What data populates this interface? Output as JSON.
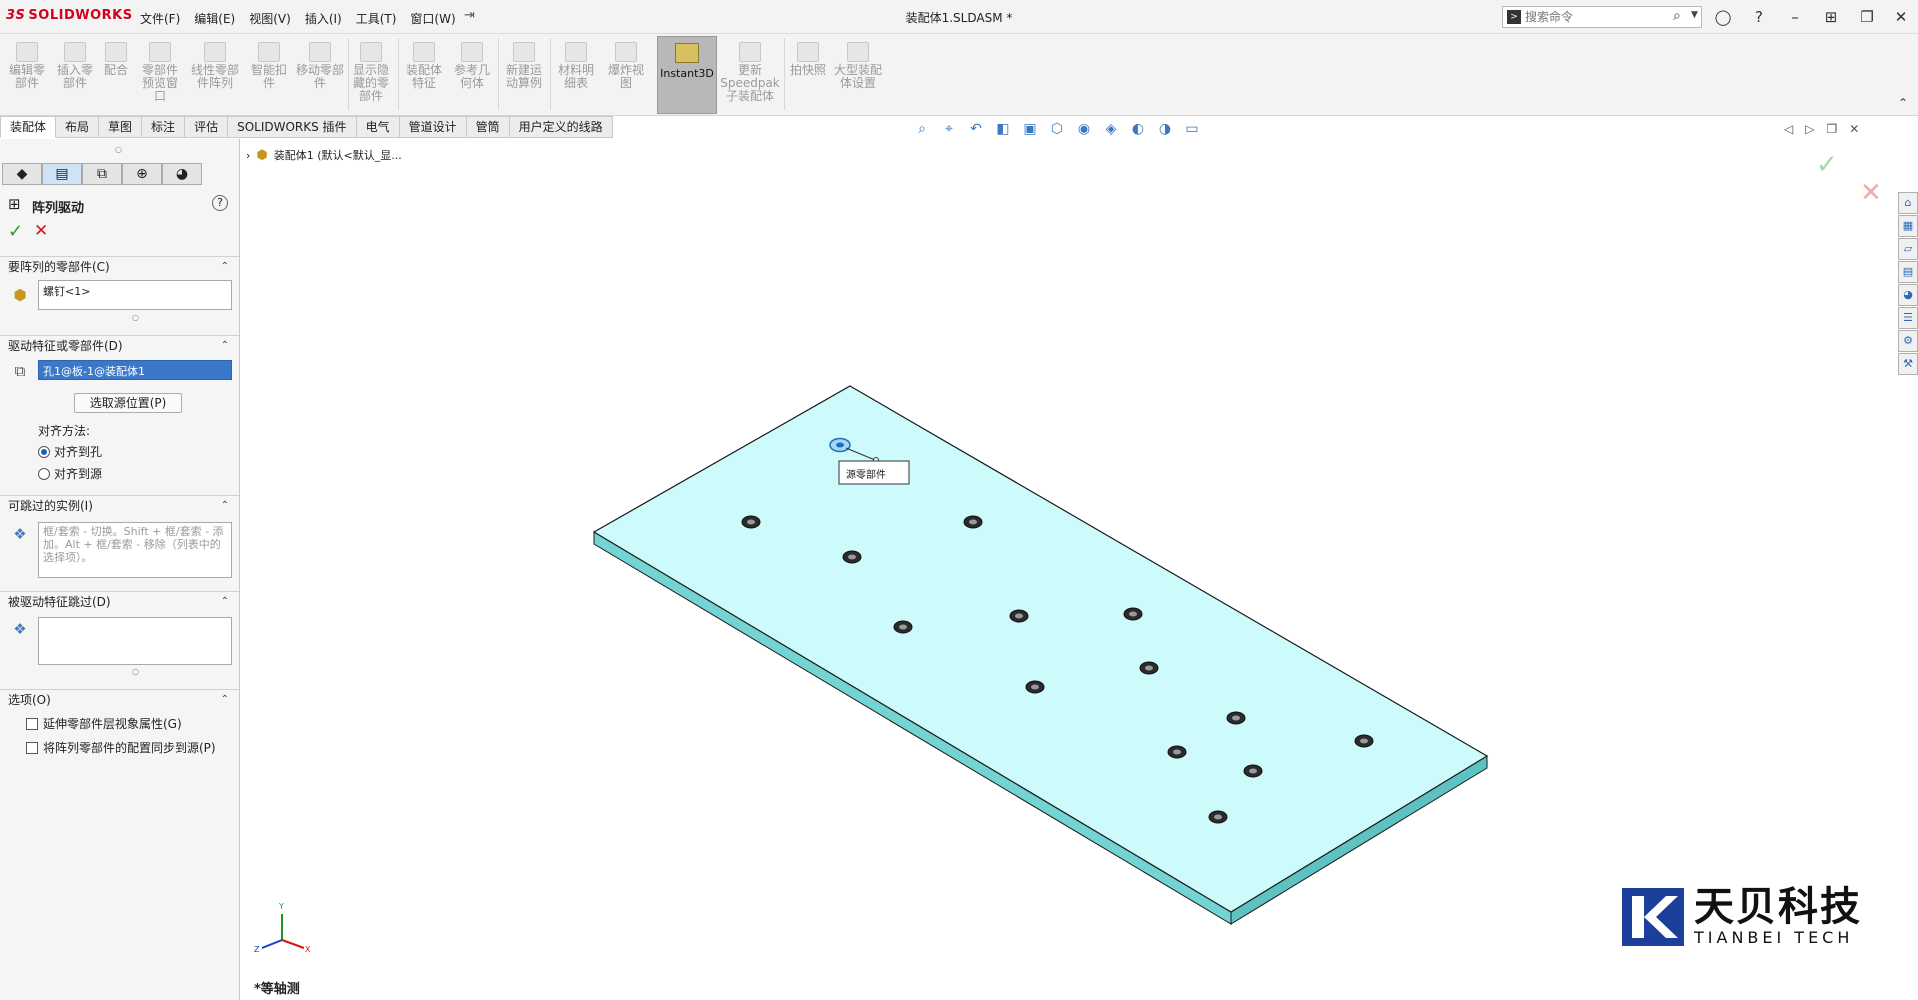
{
  "app": {
    "logo": "SOLIDWORKS",
    "logo_prefix": "3S",
    "document_title": "装配体1.SLDASM *",
    "menu": [
      "文件(F)",
      "编辑(E)",
      "视图(V)",
      "插入(I)",
      "工具(T)",
      "窗口(W)"
    ],
    "search_placeholder": "搜索命令"
  },
  "ribbon": {
    "buttons": [
      "编辑零部件",
      "插入零部件",
      "配合",
      "零部件预览窗口",
      "线性零部件阵列",
      "智能扣件",
      "移动零部件",
      "显示隐藏的零部件",
      "装配体特征",
      "参考几何体",
      "新建运动算例",
      "材料明细表",
      "爆炸视图",
      "Instant3D",
      "更新Speedpak子装配体",
      "拍快照",
      "大型装配体设置"
    ]
  },
  "tabs": [
    "装配体",
    "布局",
    "草图",
    "标注",
    "评估",
    "SOLIDWORKS 插件",
    "电气",
    "管道设计",
    "管筒",
    "用户定义的线路"
  ],
  "feature_tree_flyout": "装配体1  (默认<默认_显...",
  "property_manager": {
    "title": "阵列驱动",
    "sections": {
      "components": {
        "title": "要阵列的零部件(C)",
        "items": [
          "螺钉<1>"
        ]
      },
      "driving": {
        "title": "驱动特征或零部件(D)",
        "selected": "孔1@板-1@装配体1",
        "select_source_button": "选取源位置(P)",
        "align_label": "对齐方法:",
        "align_options": [
          "对齐到孔",
          "对齐到源"
        ]
      },
      "skip": {
        "title": "可跳过的实例(I)",
        "hint": "框/套索 - 切换。Shift + 框/套索 - 添加。Alt + 框/套索 - 移除（列表中的选择项）。"
      },
      "driven_skip": {
        "title": "被驱动特征跳过(D)"
      },
      "options": {
        "title": "选项(O)",
        "checkboxes": [
          "延伸零部件层视象属性(G)",
          "将阵列零部件的配置同步到源(P)"
        ]
      }
    }
  },
  "viewport": {
    "callout": "源零部件",
    "view_name": "*等轴测",
    "plate_color": "#cdfbfb",
    "plate_side_color": "#74d4d4",
    "axes": [
      "Y",
      "X",
      "Z"
    ]
  },
  "brand": {
    "chinese": "天贝科技",
    "english": "TIANBEI TECH"
  }
}
